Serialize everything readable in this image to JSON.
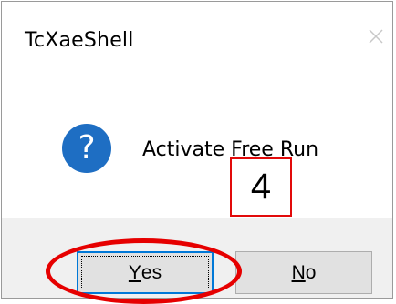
{
  "dialog": {
    "title": "TcXaeShell",
    "message": "Activate Free Run",
    "icon": "question-icon",
    "buttons": {
      "yes": {
        "label_mnemonic": "Y",
        "label_rest": "es"
      },
      "no": {
        "label_mnemonic": "N",
        "label_rest": "o"
      }
    }
  },
  "annotation": {
    "step_number": "4",
    "color": "#e60000"
  },
  "colors": {
    "icon_blue": "#1e6ec3",
    "focus_blue": "#0078d7",
    "footer_gray": "#f0f0f0"
  }
}
